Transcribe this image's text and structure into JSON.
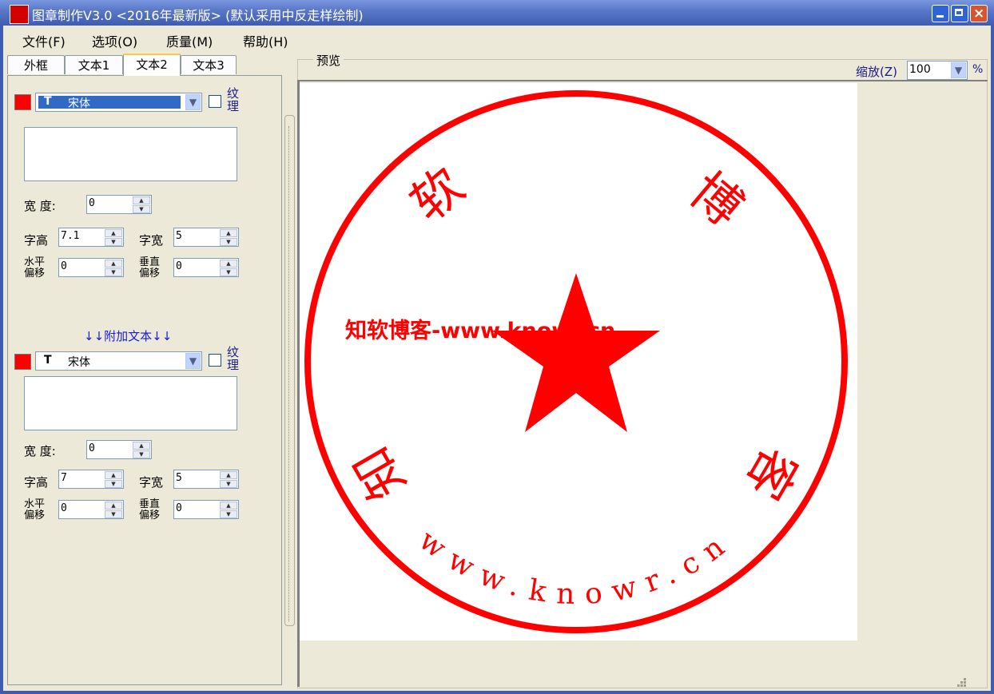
{
  "window": {
    "title": "图章制作V3.0 <2016年最新版> (默认采用中反走样绘制)",
    "logo_text": "图章制作"
  },
  "menu": [
    "文件(F)",
    "选项(O)",
    "质量(M)",
    "帮助(H)"
  ],
  "tabs": [
    {
      "label": "外框",
      "active": false
    },
    {
      "label": "文本1",
      "active": false
    },
    {
      "label": "文本2",
      "active": true
    },
    {
      "label": "文本3",
      "active": false
    }
  ],
  "main_text": {
    "color": "#ff0000",
    "font_icon": "truetype-icon",
    "font": "宋体",
    "texture_label": "纹理",
    "text_value": "",
    "width_label": "宽  度:",
    "width_value": "0",
    "char_height_label": "字高",
    "char_height_value": "7.1",
    "char_width_label": "字宽",
    "char_width_value": "5",
    "h_offset_label_1": "水平",
    "h_offset_label_2": "偏移",
    "h_offset_value": "0",
    "v_offset_label_1": "垂直",
    "v_offset_label_2": "偏移",
    "v_offset_value": "0"
  },
  "append_label": "↓↓附加文本↓↓",
  "append_text": {
    "color": "#ff0000",
    "font_icon": "truetype-icon",
    "font": "宋体",
    "texture_label": "纹理",
    "text_value": "",
    "width_label": "宽  度:",
    "width_value": "0",
    "char_height_label": "字高",
    "char_height_value": "7",
    "char_width_label": "字宽",
    "char_width_value": "5",
    "h_offset_label_1": "水平",
    "h_offset_label_2": "偏移",
    "h_offset_value": "0",
    "v_offset_label_1": "垂直",
    "v_offset_label_2": "偏移",
    "v_offset_value": "0"
  },
  "preview": {
    "group_label": "预览",
    "zoom_label": "缩放(Z)",
    "zoom_value": "100",
    "percent": "%",
    "seal": {
      "color": "#ff0000",
      "top_chars": [
        "软",
        "博",
        "客"
      ],
      "bottom_left_char": "知",
      "bottom_text": "www.knowr.cn"
    },
    "watermark": "知软博客-www.knowr.cn"
  }
}
